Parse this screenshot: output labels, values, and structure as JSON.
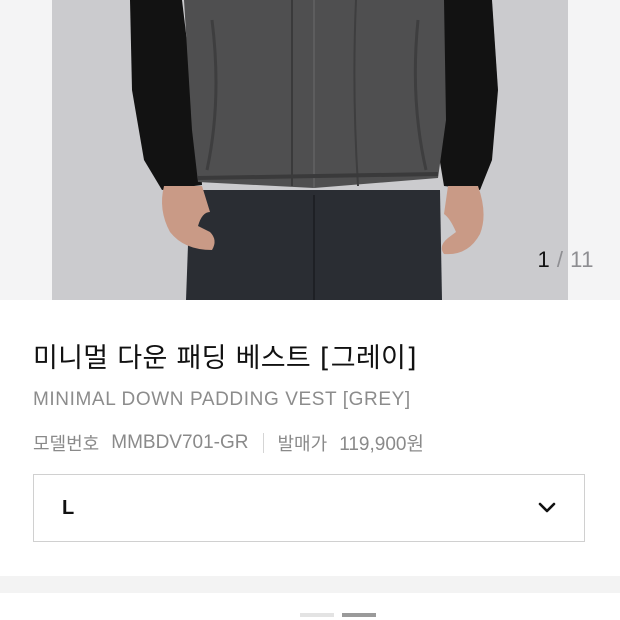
{
  "gallery": {
    "current": "1",
    "separator": "/",
    "total": "11"
  },
  "product": {
    "name_kr": "미니멀 다운 패딩 베스트 [그레이]",
    "name_en": "MINIMAL DOWN PADDING VEST [GREY]",
    "model_label": "모델번호",
    "model_value": "MMBDV701-GR",
    "price_label": "발매가",
    "price_value": "119,900원"
  },
  "size_select": {
    "value": "L",
    "icon": "chevron-down-icon"
  },
  "colors": {
    "border": "#d0d0d0",
    "muted_text": "#8c8c8c",
    "band": "#f3f3f3"
  }
}
